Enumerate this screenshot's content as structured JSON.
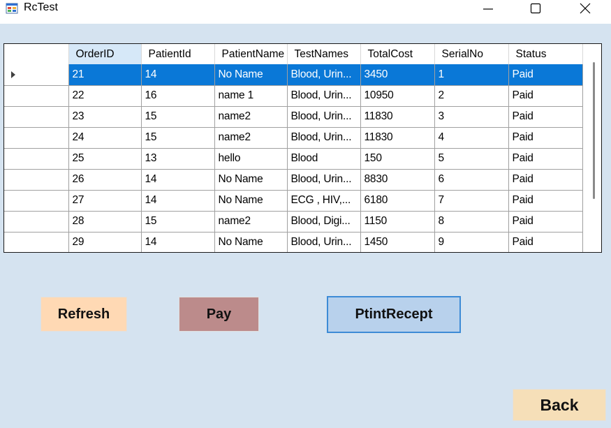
{
  "window": {
    "title": "RcTest",
    "icon": "app-form-icon",
    "controls": [
      "minimize-icon",
      "maximize-icon",
      "close-icon"
    ]
  },
  "grid": {
    "columns": [
      "OrderID",
      "PatientId",
      "PatientName",
      "TestNames",
      "TotalCost",
      "SerialNo",
      "Status"
    ],
    "selected_row_index": 0,
    "rows": [
      [
        "21",
        "14",
        "No Name",
        "Blood, Urin...",
        "3450",
        "1",
        "Paid"
      ],
      [
        "22",
        "16",
        "name 1",
        "Blood, Urin...",
        "10950",
        "2",
        "Paid"
      ],
      [
        "23",
        "15",
        "name2",
        "Blood, Urin...",
        "11830",
        "3",
        "Paid"
      ],
      [
        "24",
        "15",
        "name2",
        "Blood, Urin...",
        "11830",
        "4",
        "Paid"
      ],
      [
        "25",
        "13",
        "hello",
        "Blood",
        "150",
        "5",
        "Paid"
      ],
      [
        "26",
        "14",
        "No Name",
        "Blood, Urin...",
        "8830",
        "6",
        "Paid"
      ],
      [
        "27",
        "14",
        "No Name",
        "ECG , HIV,...",
        "6180",
        "7",
        "Paid"
      ],
      [
        "28",
        "15",
        "name2",
        "Blood, Digi...",
        "1150",
        "8",
        "Paid"
      ],
      [
        "29",
        "14",
        "No Name",
        "Blood, Urin...",
        "1450",
        "9",
        "Paid"
      ]
    ]
  },
  "buttons": {
    "refresh": "Refresh",
    "pay": "Pay",
    "print": "PtintRecept",
    "back": "Back"
  },
  "colors": {
    "client_bg": "#d5e3f0",
    "selection": "#0a78d7",
    "refresh_bg": "#ffd9b4",
    "pay_bg": "#bc8b8b",
    "print_bg": "#b8d1ec",
    "back_bg": "#f6dfb8"
  }
}
